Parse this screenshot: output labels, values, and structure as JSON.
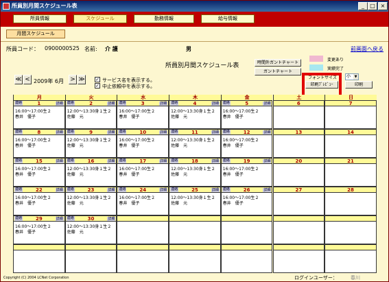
{
  "window": {
    "title": "所員別月間スケジュール表"
  },
  "topnav": [
    "所員情報",
    "スケジュール",
    "勤務情報",
    "給与情報"
  ],
  "subtab": "月間スケジュール",
  "staff": {
    "code_label": "所員コード：",
    "code": "0900000525",
    "name_label": "名前:",
    "name": "介 護",
    "gender": "男"
  },
  "back_link": "前画面へ戻る",
  "page_title": "所員別月間スケジュール表",
  "buttons": {
    "gantt_outside": "時間外ガントチャート",
    "gantt": "ガントチャート",
    "print_preview": "印刷ﾌﾟﾚﾋﾞｭｰ",
    "print": "印刷"
  },
  "legend": [
    {
      "label": "変更あり",
      "color": "#f0b8d0"
    },
    {
      "label": "実績完了",
      "color": "#a8e8f0"
    }
  ],
  "font_size_label": "フォントサイズ",
  "font_size_value": "小",
  "date": {
    "year": "2009",
    "year_suffix": "年",
    "month": "6",
    "month_suffix": "月"
  },
  "nav": [
    "≪",
    "<",
    ">",
    "≫"
  ],
  "checks": [
    {
      "label": "サービス名を表示する。",
      "checked": "✓"
    },
    {
      "label": "中止依頼中を表示する。",
      "checked": "✓"
    }
  ],
  "weekdays": [
    "月",
    "火",
    "水",
    "木",
    "金",
    "土",
    "日"
  ],
  "weekday_colors": [
    "#a00000",
    "#a00000",
    "#a00000",
    "#a00000",
    "#a00000",
    "#a00000",
    "#a00000"
  ],
  "cell_tags": {
    "left": "連絡",
    "right": "詳細"
  },
  "weeks": [
    [
      {
        "day": "1",
        "l1": "16:00～17:00生２",
        "l2": "春井　優子"
      },
      {
        "day": "2",
        "l1": "12:00～13:30身１生２",
        "l2": "佐藤　元"
      },
      {
        "day": "3",
        "l1": "16:00～17:00生２",
        "l2": "春井　優子"
      },
      {
        "day": "4",
        "l1": "12:00～13:30身１生２",
        "l2": "佐藤　元"
      },
      {
        "day": "5",
        "l1": "16:00～17:00生２",
        "l2": "春井　優子"
      },
      {
        "day": "6",
        "l1": "",
        "l2": ""
      },
      {
        "day": "7",
        "l1": "",
        "l2": ""
      }
    ],
    [
      {
        "day": "8",
        "l1": "16:00～17:00生２",
        "l2": "春井　優子"
      },
      {
        "day": "9",
        "l1": "12:00～13:30身１生２",
        "l2": "佐藤　元"
      },
      {
        "day": "10",
        "l1": "16:00～17:00生２",
        "l2": "春井　優子"
      },
      {
        "day": "11",
        "l1": "12:00～13:30身１生２",
        "l2": "佐藤　元"
      },
      {
        "day": "12",
        "l1": "16:00～17:00生２",
        "l2": "春井　優子"
      },
      {
        "day": "13",
        "l1": "",
        "l2": ""
      },
      {
        "day": "14",
        "l1": "",
        "l2": ""
      }
    ],
    [
      {
        "day": "15",
        "l1": "16:00～17:00生２",
        "l2": "春井　優子"
      },
      {
        "day": "16",
        "l1": "12:00～13:30身１生２",
        "l2": "佐藤　元"
      },
      {
        "day": "17",
        "l1": "16:00～17:00生２",
        "l2": "春井　優子"
      },
      {
        "day": "18",
        "l1": "12:00～13:30身１生２",
        "l2": "佐藤　元"
      },
      {
        "day": "19",
        "l1": "16:00～17:00生２",
        "l2": "春井　優子"
      },
      {
        "day": "20",
        "l1": "",
        "l2": ""
      },
      {
        "day": "21",
        "l1": "",
        "l2": ""
      }
    ],
    [
      {
        "day": "22",
        "l1": "16:00～17:00生２",
        "l2": "春井　優子"
      },
      {
        "day": "23",
        "l1": "12:00～13:30身１生２",
        "l2": "佐藤　元"
      },
      {
        "day": "24",
        "l1": "16:00～17:00生２",
        "l2": "春井　優子"
      },
      {
        "day": "25",
        "l1": "12:00～13:30身１生２",
        "l2": "佐藤　元"
      },
      {
        "day": "26",
        "l1": "16:00～17:00生２",
        "l2": "春井　優子"
      },
      {
        "day": "27",
        "l1": "",
        "l2": ""
      },
      {
        "day": "28",
        "l1": "",
        "l2": ""
      }
    ],
    [
      {
        "day": "29",
        "l1": "16:00～17:00生２",
        "l2": "春井　優子"
      },
      {
        "day": "30",
        "l1": "12:00～13:30身１生２",
        "l2": "佐藤　元"
      },
      {
        "day": "",
        "l1": "",
        "l2": ""
      },
      {
        "day": "",
        "l1": "",
        "l2": ""
      },
      {
        "day": "",
        "l1": "",
        "l2": ""
      },
      {
        "day": "",
        "l1": "",
        "l2": ""
      },
      {
        "day": "",
        "l1": "",
        "l2": ""
      }
    ],
    [
      {
        "day": "",
        "l1": "",
        "l2": ""
      },
      {
        "day": "",
        "l1": "",
        "l2": ""
      },
      {
        "day": "",
        "l1": "",
        "l2": ""
      },
      {
        "day": "",
        "l1": "",
        "l2": ""
      },
      {
        "day": "",
        "l1": "",
        "l2": ""
      },
      {
        "day": "",
        "l1": "",
        "l2": ""
      },
      {
        "day": "",
        "l1": "",
        "l2": ""
      }
    ]
  ],
  "footer": "Copyright (C) 2004 LCNet Corporation",
  "login_label": "ログインユーザー：",
  "login_value": "春川"
}
